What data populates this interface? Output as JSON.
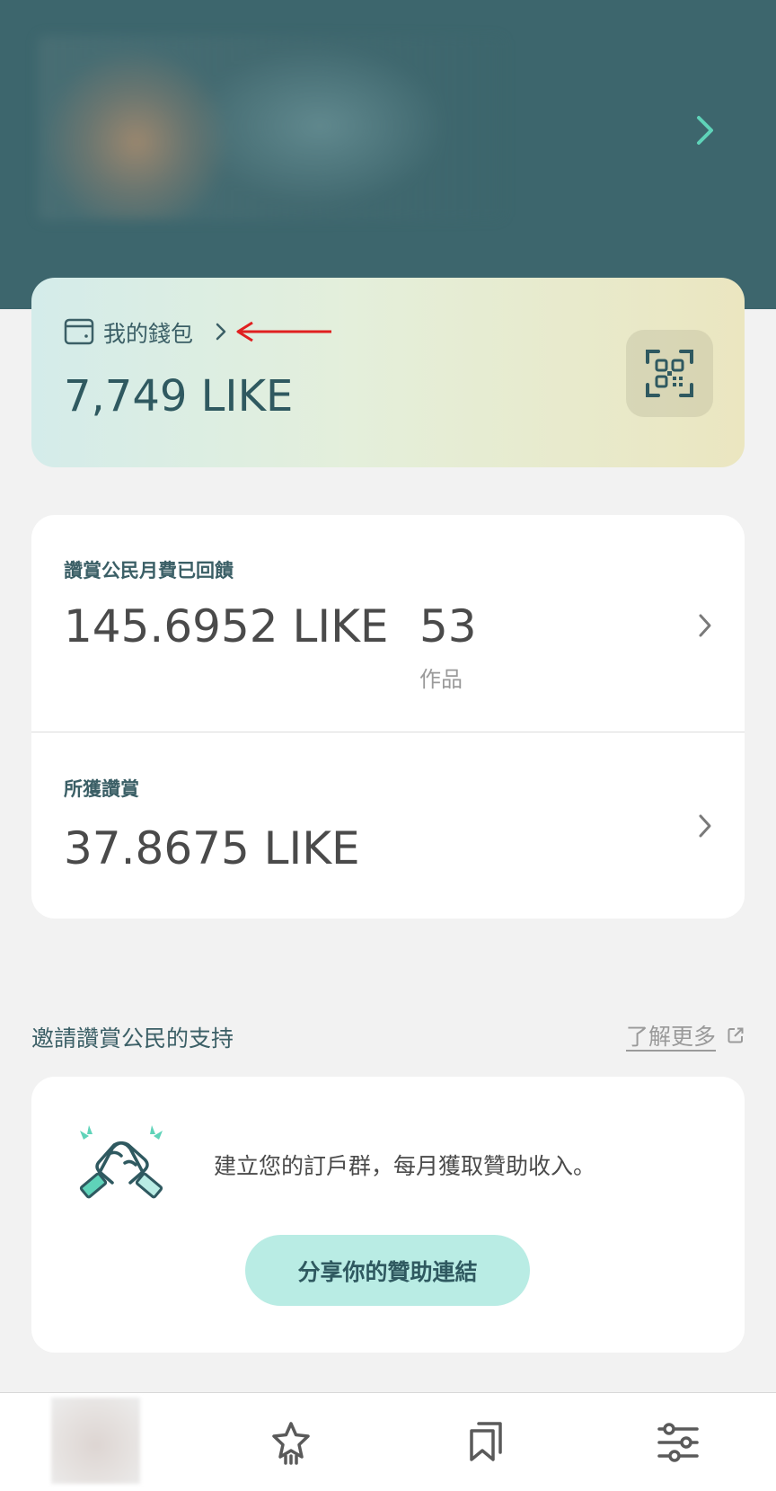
{
  "wallet": {
    "label": "我的錢包",
    "amount": "7,749 LIKE"
  },
  "stats": {
    "supporters": {
      "label": "讚賞公民月費已回饋",
      "amount": "145.6952 LIKE",
      "works_count": "53",
      "works_label": "作品"
    },
    "received": {
      "label": "所獲讚賞",
      "amount": "37.8675 LIKE"
    }
  },
  "invite": {
    "section_title": "邀請讚賞公民的支持",
    "learn_more": "了解更多",
    "description": "建立您的訂戶群，每月獲取贊助收入。",
    "share_button": "分享你的贊助連結"
  },
  "colors": {
    "header_bg": "#3d666d",
    "accent_teal": "#5fd3b9",
    "button_bg": "#b9ece4",
    "annotation_arrow": "#e02020"
  },
  "icons": {
    "profile_chevron": "chevron-right-icon",
    "wallet": "wallet-icon",
    "qr": "qr-scan-icon",
    "external": "external-link-icon",
    "handshake": "handshake-icon",
    "nav": [
      "avatar",
      "star-icon",
      "bookmarks-icon",
      "settings-sliders-icon"
    ]
  }
}
